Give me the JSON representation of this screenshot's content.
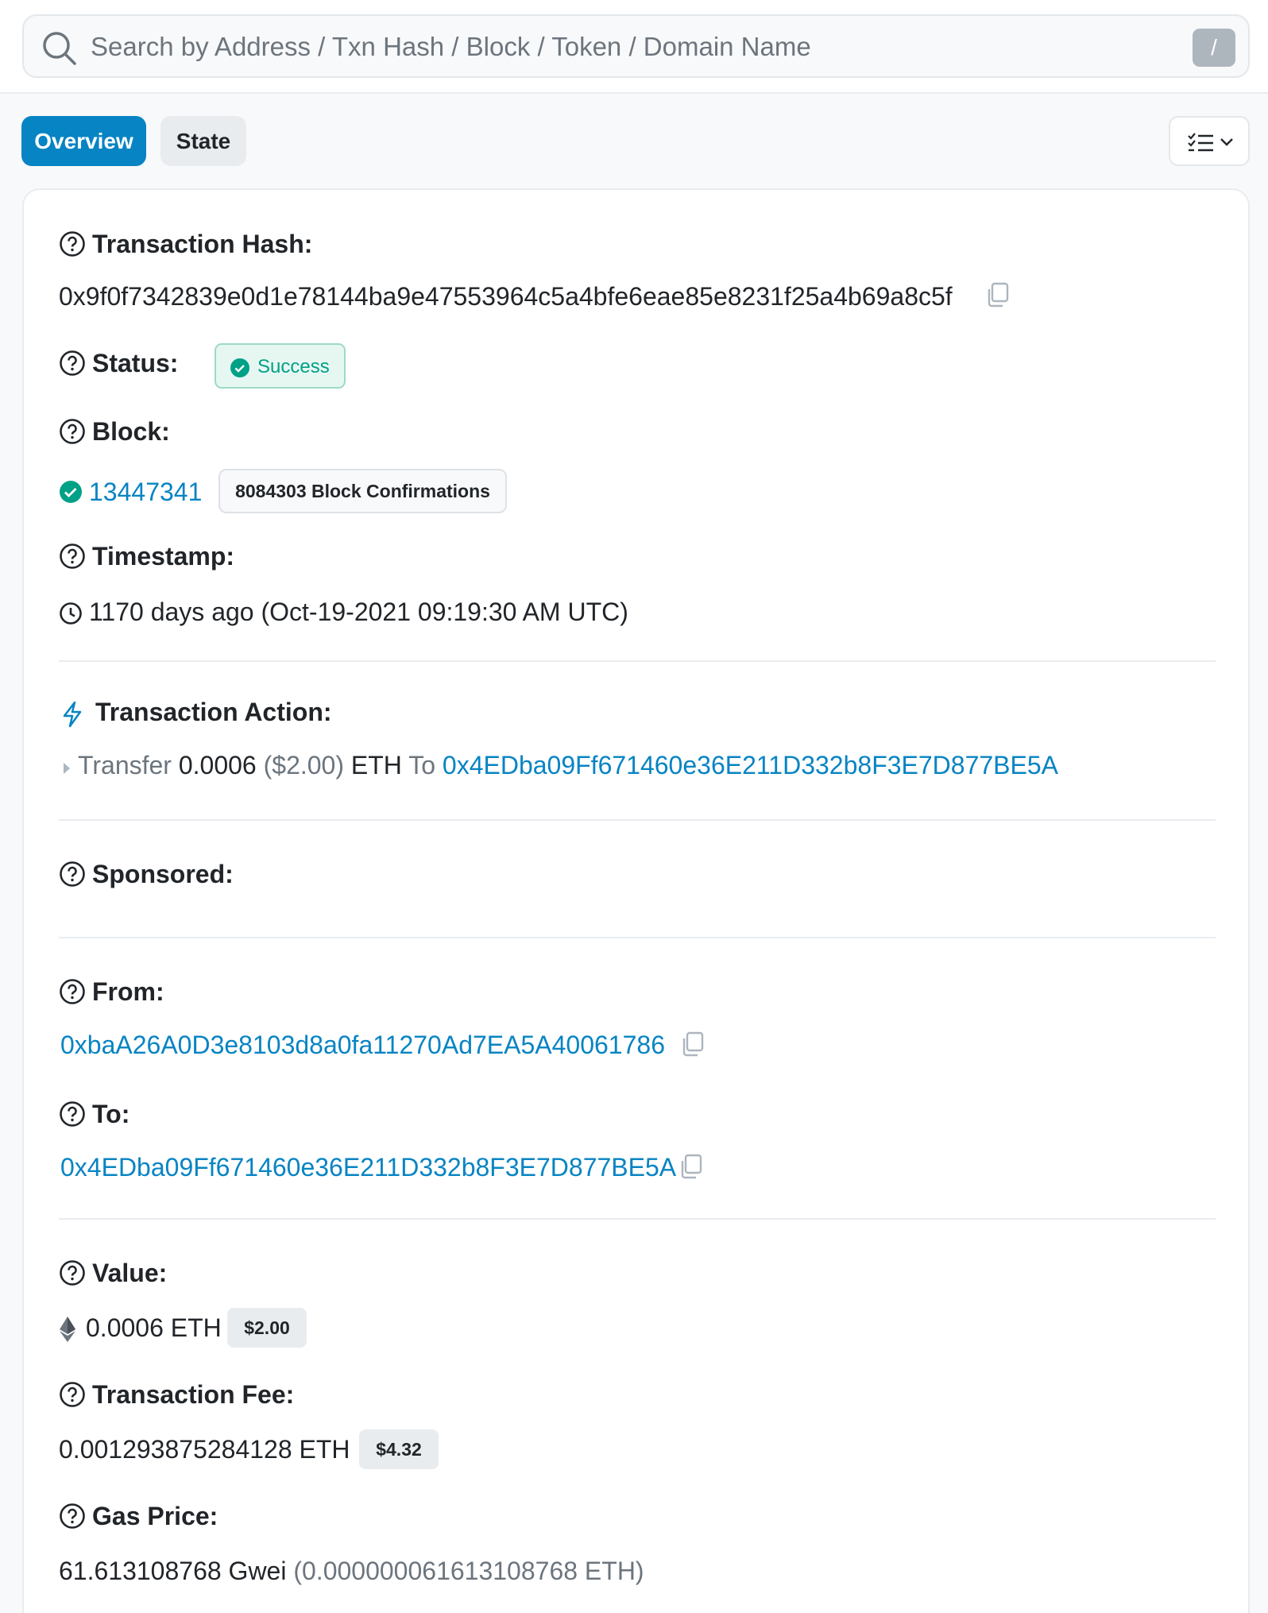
{
  "search": {
    "placeholder": "Search by Address / Txn Hash / Block / Token / Domain Name",
    "shortcut": "/"
  },
  "tabs": [
    {
      "label": "Overview",
      "active": true
    },
    {
      "label": "State",
      "active": false
    }
  ],
  "colors": {
    "accent": "#0784c3",
    "success": "#00a186",
    "text": "#212529",
    "muted": "#6c757d"
  },
  "overview": {
    "tx_hash": {
      "label": "Transaction Hash:",
      "value": "0x9f0f7342839e0d1e78144ba9e47553964c5a4bfe6eae85e8231f25a4b69a8c5f"
    },
    "status": {
      "label": "Status:",
      "value": "Success"
    },
    "block": {
      "label": "Block:",
      "number": "13447341",
      "confirmations": "8084303 Block Confirmations"
    },
    "timestamp": {
      "label": "Timestamp:",
      "value": "1170 days ago (Oct-19-2021 09:19:30 AM UTC)"
    },
    "action": {
      "label": "Transaction Action:",
      "verb": "Transfer",
      "amount": "0.0006",
      "usd": "($2.00)",
      "unit": "ETH",
      "to_word": "To",
      "to_address": "0x4EDba09Ff671460e36E211D332b8F3E7D877BE5A"
    },
    "sponsored": {
      "label": "Sponsored:"
    },
    "from": {
      "label": "From:",
      "value": "0xbaA26A0D3e8103d8a0fa11270Ad7EA5A40061786"
    },
    "to": {
      "label": "To:",
      "value": "0x4EDba09Ff671460e36E211D332b8F3E7D877BE5A"
    },
    "value": {
      "label": "Value:",
      "amount": "0.0006 ETH",
      "usd": "$2.00"
    },
    "fee": {
      "label": "Transaction Fee:",
      "amount": "0.001293875284128 ETH",
      "usd": "$4.32"
    },
    "gas_price": {
      "label": "Gas Price:",
      "gwei": "61.613108768 Gwei",
      "eth": "(0.000000061613108768 ETH)"
    }
  }
}
